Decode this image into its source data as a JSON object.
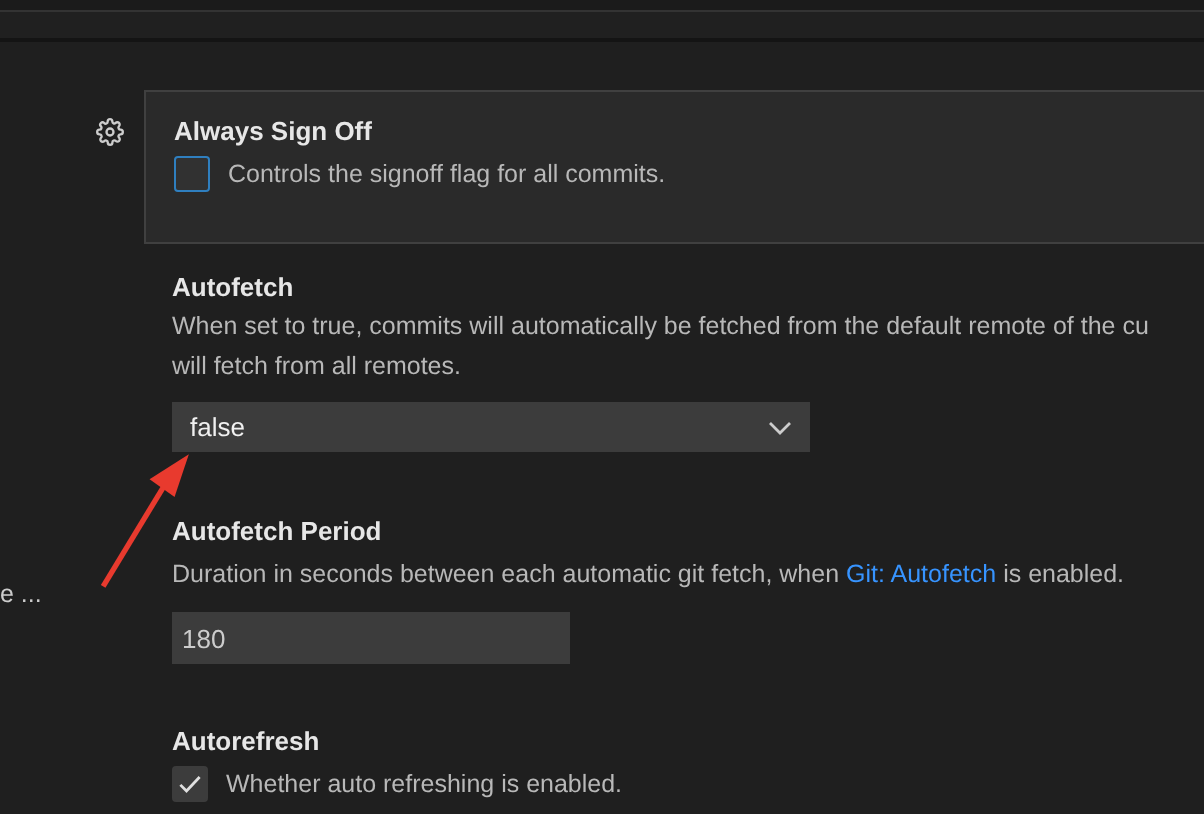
{
  "sidebar": {
    "items": [
      {
        "label": "e ..."
      }
    ]
  },
  "settings": [
    {
      "kind": "checkbox",
      "title": "Always Sign Off",
      "focused": true,
      "description_lines": [
        "Controls the signoff flag for all commits."
      ],
      "checked": false
    },
    {
      "kind": "select",
      "title": "Autofetch",
      "focused": false,
      "description_lines": [
        "When set to true, commits will automatically be fetched from the default remote of the cu",
        "will fetch from all remotes."
      ],
      "value": "false"
    },
    {
      "kind": "number",
      "title": "Autofetch Period",
      "focused": false,
      "description_before": "Duration in seconds between each automatic git fetch, when",
      "link": "Git: Autofetch",
      "description_after": "is enabled.",
      "value": "180"
    },
    {
      "kind": "checkbox",
      "title": "Autorefresh",
      "focused": false,
      "description_lines": [
        "Whether auto refreshing is enabled."
      ],
      "checked": true
    }
  ]
}
